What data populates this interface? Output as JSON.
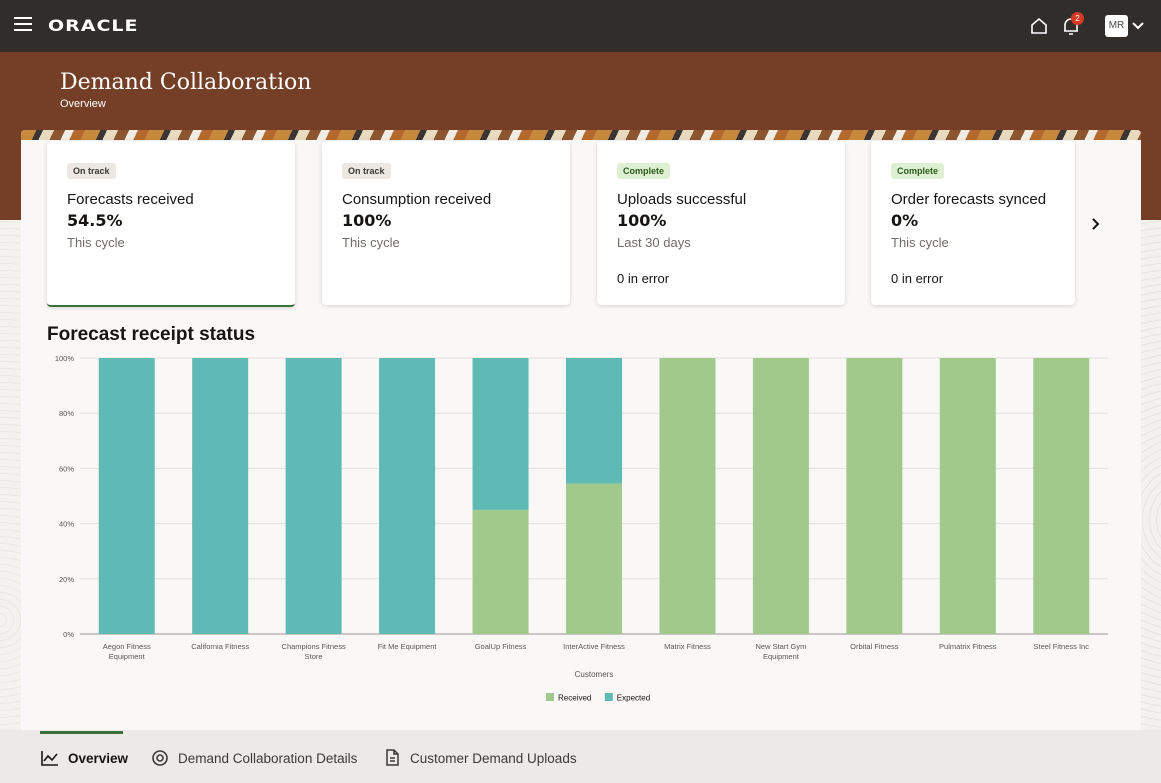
{
  "app": {
    "logo": "ORACLE",
    "notification_count": "2",
    "avatar_initials": "MR"
  },
  "page": {
    "title": "Demand Collaboration",
    "subtitle": "Overview"
  },
  "cards": [
    {
      "status": "On track",
      "title": "Forecasts received",
      "value": "54.5%",
      "period": "This cycle",
      "error": ""
    },
    {
      "status": "On track",
      "title": "Consumption received",
      "value": "100%",
      "period": "This cycle",
      "error": ""
    },
    {
      "status": "Complete",
      "title": "Uploads successful",
      "value": "100%",
      "period": "Last 30 days",
      "error": "0 in error"
    },
    {
      "status": "Complete",
      "title": "Order forecasts synced",
      "value": "0%",
      "period": "This cycle",
      "error": "0 in error"
    }
  ],
  "chart_heading": "Forecast receipt status",
  "chart_data": {
    "type": "bar",
    "stacked": true,
    "categories": [
      "Aegon Fitness Equipment",
      "California Fitness",
      "Champions Fitness Store",
      "Fit Me Equipment",
      "GoalUp Fitness",
      "InterActive Fitness",
      "Matrix Fitness",
      "New Start Gym Equipment",
      "Orbital Fitness",
      "Pulmatrix Fitness",
      "Steel Fitness Inc"
    ],
    "series": [
      {
        "name": "Received",
        "color": "#a0c98b",
        "values": [
          0,
          0,
          0,
          0,
          45,
          54.5,
          100,
          100,
          100,
          100,
          100
        ]
      },
      {
        "name": "Expected",
        "color": "#5fb9b5",
        "values": [
          100,
          100,
          100,
          100,
          55,
          45.5,
          0,
          0,
          0,
          0,
          0
        ]
      }
    ],
    "yticks": [
      "0%",
      "20%",
      "40%",
      "60%",
      "80%",
      "100%"
    ],
    "xlabel": "Customers",
    "ylabel": "",
    "ylim": [
      0,
      100
    ],
    "legend": "bottom-center",
    "grid": true
  },
  "tabs": [
    {
      "label": "Overview",
      "icon": "line-chart-icon"
    },
    {
      "label": "Demand Collaboration Details",
      "icon": "target-icon"
    },
    {
      "label": "Customer Demand Uploads",
      "icon": "document-upload-icon"
    }
  ]
}
